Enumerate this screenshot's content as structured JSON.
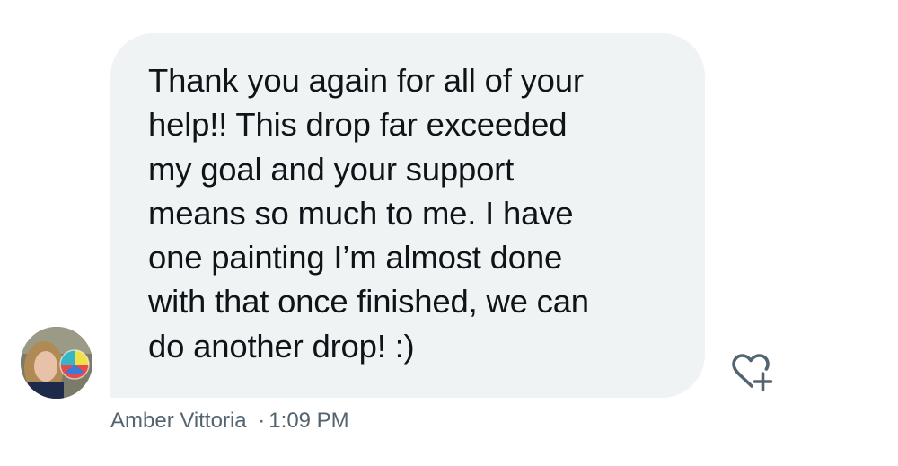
{
  "message": {
    "text": "Thank you again for all of your\nhelp!! This drop far exceeded\nmy goal and your support\nmeans so much to me. I have\none painting I’m almost done\nwith that once finished, we can\ndo another drop! :)",
    "sender_name": "Amber Vittoria",
    "separator": "·",
    "time": "1:09 PM"
  },
  "icons": {
    "avatar": "user-avatar-photo",
    "react": "heart-plus-icon"
  },
  "colors": {
    "bubble_bg": "#eff3f4",
    "text": "#0f1419",
    "meta": "#536471",
    "icon": "#536471"
  }
}
